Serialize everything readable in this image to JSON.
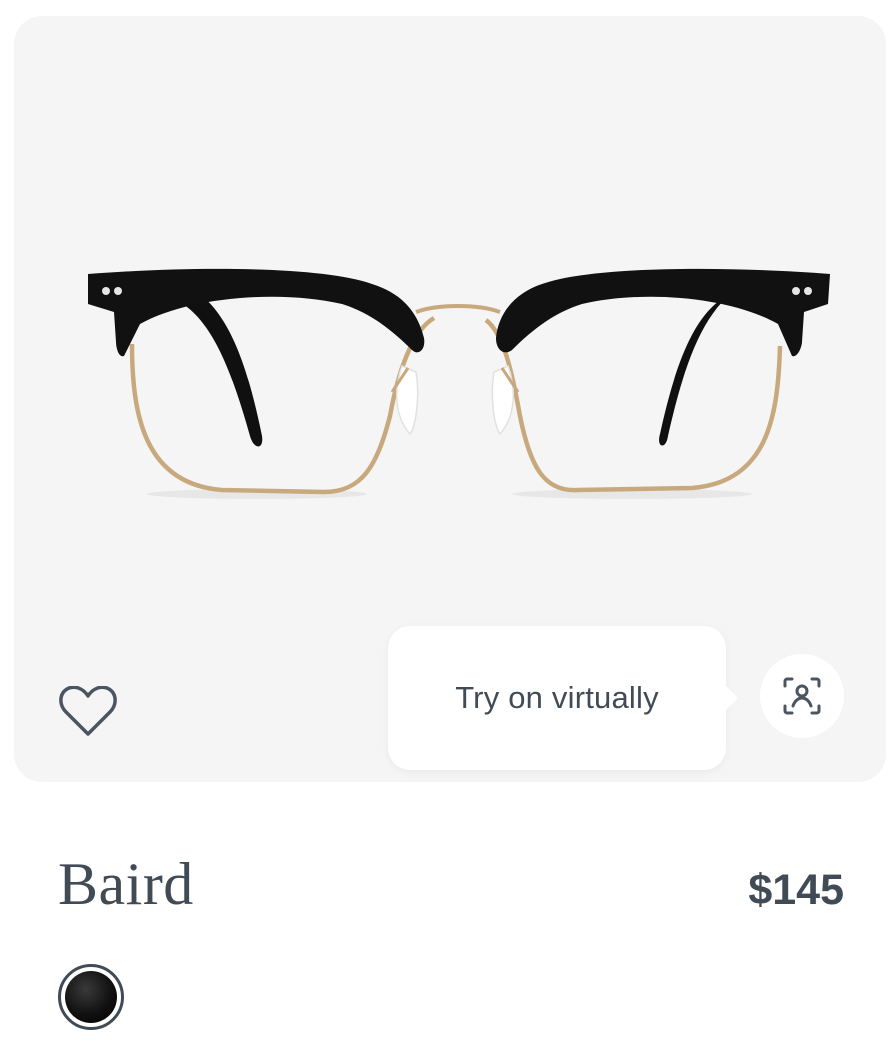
{
  "product": {
    "name": "Baird",
    "price": "$145",
    "image_alt": "Baird eyeglasses in black and gold",
    "selected_color": "#0b0b0b"
  },
  "actions": {
    "favorite_icon": "heart-icon",
    "tryon_icon": "face-scan-icon",
    "tryon_tooltip": "Try on virtually"
  },
  "colors": {
    "card_background": "#f5f5f6",
    "text": "#414b56",
    "frame_black": "#111111",
    "frame_gold": "#c8a97d"
  }
}
